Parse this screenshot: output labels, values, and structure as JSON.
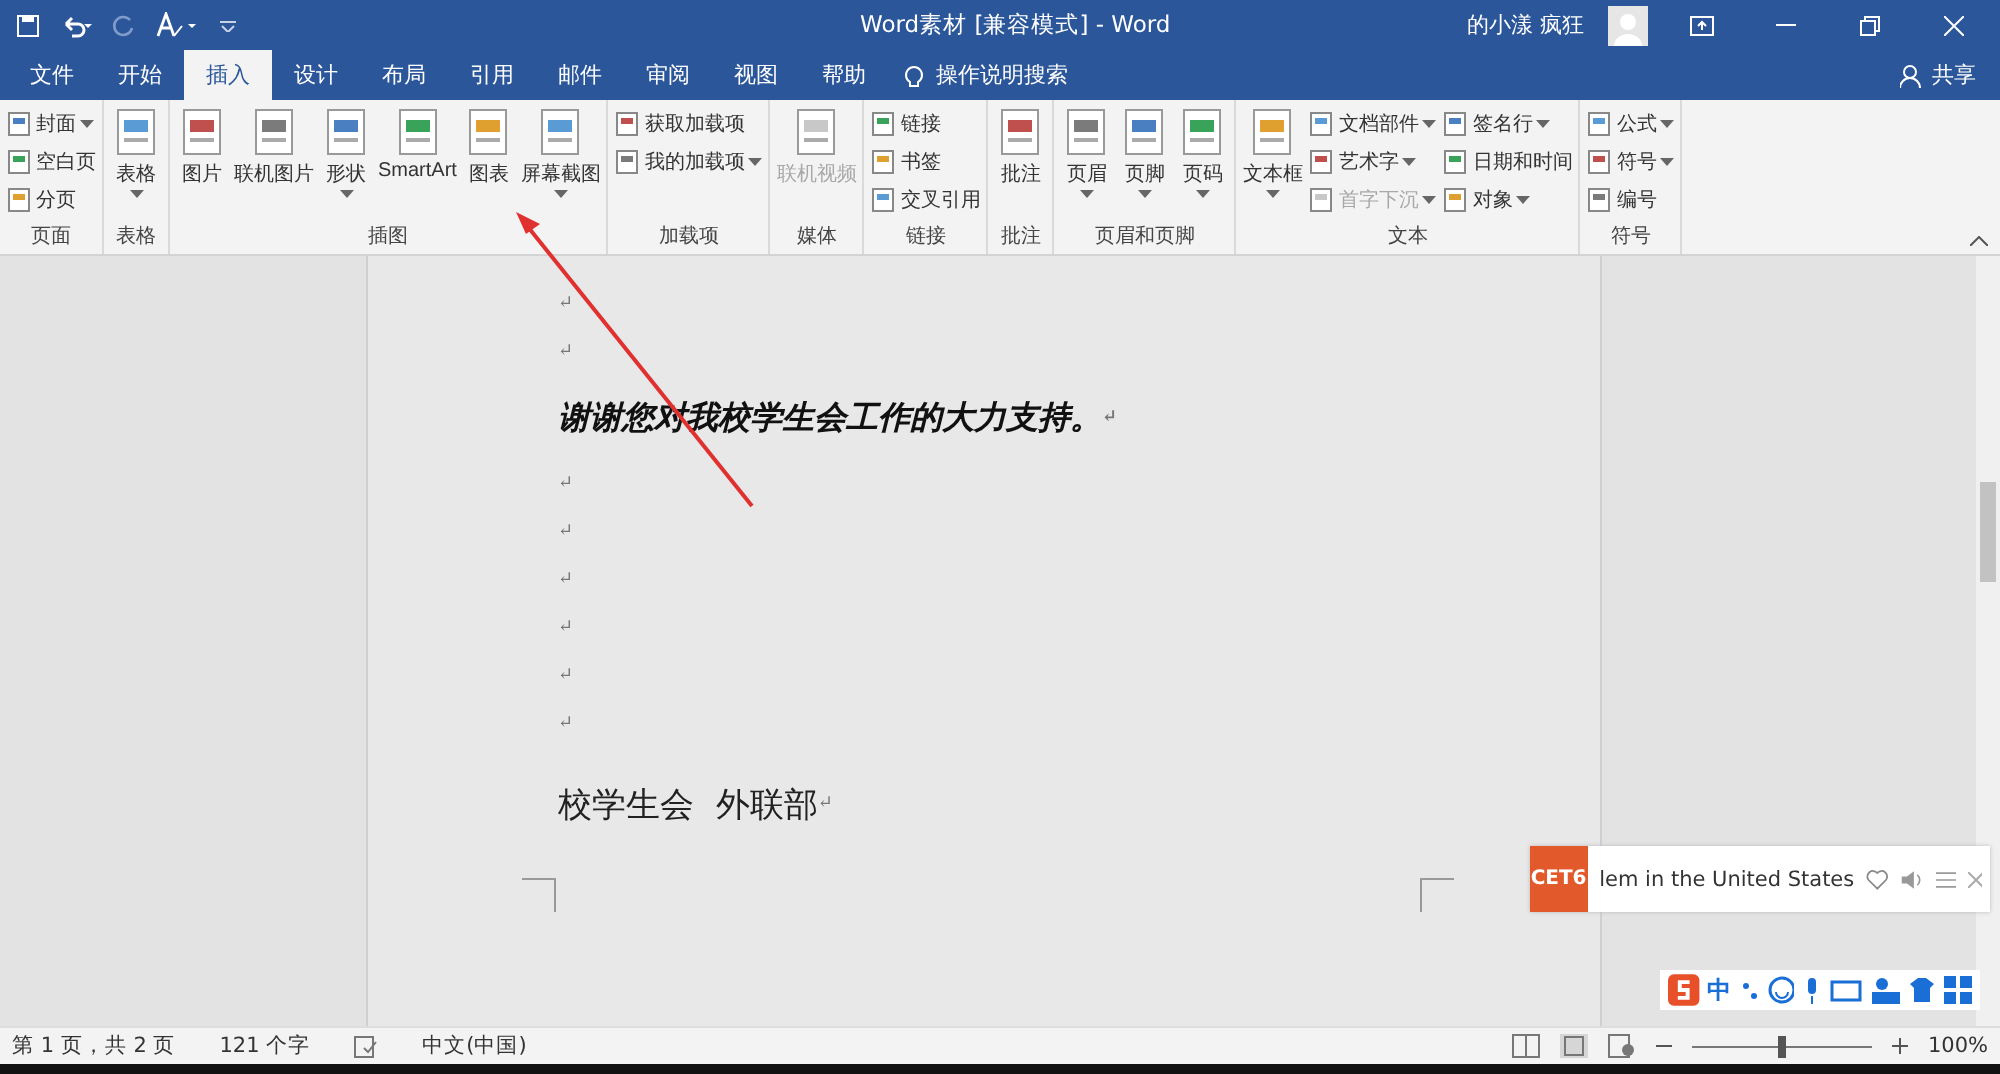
{
  "window": {
    "title": "Word素材 [兼容模式] - Word",
    "user": "的小漾 疯狂"
  },
  "tabs": [
    {
      "label": "文件",
      "selected": false
    },
    {
      "label": "开始",
      "selected": false
    },
    {
      "label": "插入",
      "selected": true
    },
    {
      "label": "设计",
      "selected": false
    },
    {
      "label": "布局",
      "selected": false
    },
    {
      "label": "引用",
      "selected": false
    },
    {
      "label": "邮件",
      "selected": false
    },
    {
      "label": "审阅",
      "selected": false
    },
    {
      "label": "视图",
      "selected": false
    },
    {
      "label": "帮助",
      "selected": false
    }
  ],
  "tell_me": "操作说明搜索",
  "share": "共享",
  "ribbon": [
    {
      "label": "页面",
      "columns": [
        {
          "kind": "stack",
          "items": [
            {
              "label": "封面",
              "dropdown": true,
              "disabled": false
            },
            {
              "label": "空白页",
              "dropdown": false,
              "disabled": false
            },
            {
              "label": "分页",
              "dropdown": false,
              "disabled": false
            }
          ]
        }
      ]
    },
    {
      "label": "表格",
      "columns": [
        {
          "kind": "large",
          "label": "表格",
          "dropdown": true,
          "disabled": false
        }
      ]
    },
    {
      "label": "插图",
      "columns": [
        {
          "kind": "large",
          "label": "图片",
          "dropdown": false,
          "disabled": false
        },
        {
          "kind": "large",
          "label": "联机图片",
          "dropdown": false,
          "disabled": false
        },
        {
          "kind": "large",
          "label": "形状",
          "dropdown": true,
          "disabled": false
        },
        {
          "kind": "large",
          "label": "SmartArt",
          "dropdown": false,
          "disabled": false
        },
        {
          "kind": "large",
          "label": "图表",
          "dropdown": false,
          "disabled": false
        },
        {
          "kind": "large",
          "label": "屏幕截图",
          "dropdown": true,
          "disabled": false
        }
      ]
    },
    {
      "label": "加载项",
      "columns": [
        {
          "kind": "stack",
          "items": [
            {
              "label": "获取加载项",
              "dropdown": false,
              "disabled": false
            },
            {
              "label": "我的加载项",
              "dropdown": true,
              "disabled": false
            }
          ]
        }
      ]
    },
    {
      "label": "媒体",
      "columns": [
        {
          "kind": "large",
          "label": "联机视频",
          "dropdown": false,
          "disabled": true
        }
      ]
    },
    {
      "label": "链接",
      "columns": [
        {
          "kind": "stack",
          "items": [
            {
              "label": "链接",
              "dropdown": false,
              "disabled": false
            },
            {
              "label": "书签",
              "dropdown": false,
              "disabled": false
            },
            {
              "label": "交叉引用",
              "dropdown": false,
              "disabled": false
            }
          ]
        }
      ]
    },
    {
      "label": "批注",
      "columns": [
        {
          "kind": "large",
          "label": "批注",
          "dropdown": false,
          "disabled": false
        }
      ]
    },
    {
      "label": "页眉和页脚",
      "columns": [
        {
          "kind": "large",
          "label": "页眉",
          "dropdown": true,
          "disabled": false
        },
        {
          "kind": "large",
          "label": "页脚",
          "dropdown": true,
          "disabled": false
        },
        {
          "kind": "large",
          "label": "页码",
          "dropdown": true,
          "disabled": false
        }
      ]
    },
    {
      "label": "文本",
      "columns": [
        {
          "kind": "large",
          "label": "文本框",
          "dropdown": true,
          "disabled": false
        },
        {
          "kind": "stack",
          "items": [
            {
              "label": "文档部件",
              "dropdown": true,
              "disabled": false
            },
            {
              "label": "艺术字",
              "dropdown": true,
              "disabled": false
            },
            {
              "label": "首字下沉",
              "dropdown": true,
              "disabled": true
            }
          ]
        },
        {
          "kind": "stack",
          "items": [
            {
              "label": "签名行",
              "dropdown": true,
              "disabled": false
            },
            {
              "label": "日期和时间",
              "dropdown": false,
              "disabled": false
            },
            {
              "label": "对象",
              "dropdown": true,
              "disabled": false
            }
          ]
        }
      ]
    },
    {
      "label": "符号",
      "columns": [
        {
          "kind": "stack",
          "items": [
            {
              "label": "公式",
              "dropdown": true,
              "disabled": false
            },
            {
              "label": "符号",
              "dropdown": true,
              "disabled": false
            },
            {
              "label": "编号",
              "dropdown": false,
              "disabled": false
            }
          ]
        }
      ]
    }
  ],
  "document": [
    {
      "kind": "mark",
      "text": "↵"
    },
    {
      "kind": "mark",
      "text": "↵"
    },
    {
      "kind": "emphasis",
      "text": "谢谢您对我校学生会工作的大力支持。",
      "mark": "↵"
    },
    {
      "kind": "mark",
      "text": "↵"
    },
    {
      "kind": "mark",
      "text": "↵"
    },
    {
      "kind": "mark",
      "text": "↵"
    },
    {
      "kind": "mark",
      "text": "↵"
    },
    {
      "kind": "mark",
      "text": "↵"
    },
    {
      "kind": "mark",
      "text": "↵"
    },
    {
      "kind": "signature",
      "text": "校学生会  外联部",
      "mark": "↵"
    }
  ],
  "popup": {
    "logo": "CET6",
    "text": "lem in the United States"
  },
  "ime": {
    "mode": "中"
  },
  "status_bar": {
    "page": "第 1 页，共 2 页",
    "words": "121 个字",
    "language": "中文(中国)",
    "zoom": "100%",
    "zoom_slider": {
      "level": 0.5
    }
  }
}
